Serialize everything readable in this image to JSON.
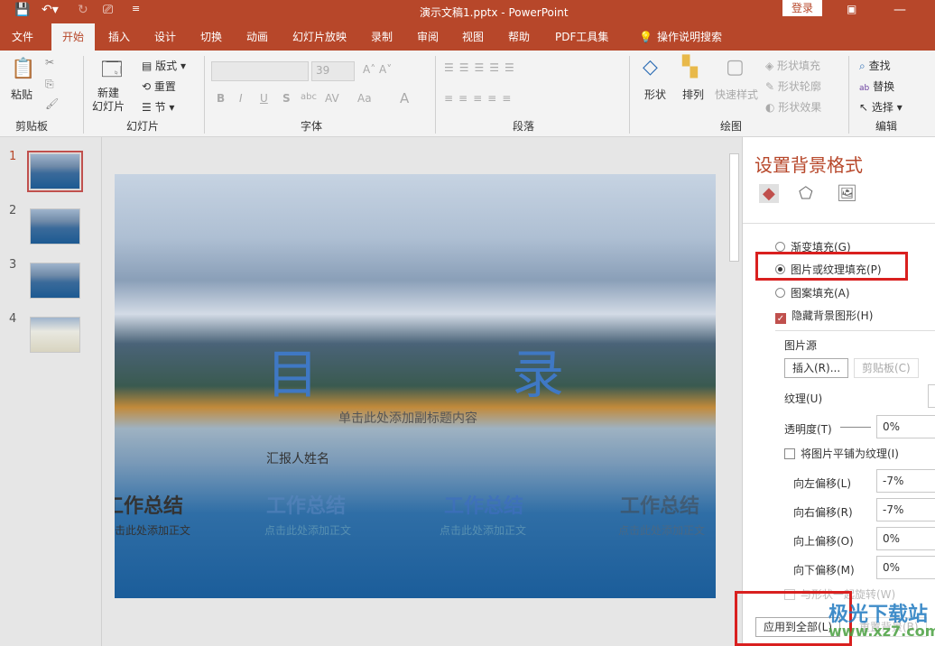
{
  "titlebar": {
    "title": "演示文稿1.pptx  -  PowerPoint",
    "login": "登录",
    "icons": [
      "save-icon",
      "undo-icon",
      "redo-icon",
      "present-icon",
      "customize-icon"
    ]
  },
  "tabs": [
    "文件",
    "开始",
    "插入",
    "设计",
    "切换",
    "动画",
    "幻灯片放映",
    "录制",
    "审阅",
    "视图",
    "帮助",
    "PDF工具集",
    "操作说明搜索"
  ],
  "ribbon": {
    "clipboard": {
      "paste": "粘贴",
      "group": "剪贴板"
    },
    "slides": {
      "new_slide": "新建\n幻灯片",
      "layout": "版式",
      "reset": "重置",
      "section": "节",
      "group": "幻灯片"
    },
    "font": {
      "size": "39",
      "group": "字体",
      "bold": "B",
      "italic": "I",
      "underline": "U",
      "shadow": "S",
      "strike": "abc",
      "spacing": "AV",
      "case": "Aa",
      "color": "A"
    },
    "paragraph": {
      "group": "段落"
    },
    "drawing": {
      "shape": "形状",
      "arrange": "排列",
      "quick_style": "快速样式",
      "fill": "形状填充",
      "outline": "形状轮廓",
      "effect": "形状效果",
      "group": "绘图"
    },
    "editing": {
      "find": "查找",
      "replace": "替换",
      "select": "选择",
      "group": "编辑"
    }
  },
  "thumbnails": [
    "1",
    "2",
    "3",
    "4"
  ],
  "slide": {
    "title_left": "目",
    "title_right": "录",
    "subtitle": "单击此处添加副标题内容",
    "reporter": "汇报人姓名",
    "sections": [
      {
        "title": "工作总结",
        "body": "点击此处添加正文"
      },
      {
        "title": "工作总结",
        "body": "点击此处添加正文"
      },
      {
        "title": "工作总结",
        "body": "点击此处添加正文"
      },
      {
        "title": "工作总结",
        "body": "点击此处添加正文"
      }
    ]
  },
  "panel": {
    "title": "设置背景格式",
    "gradient": "渐变填充(G)",
    "picture": "图片或纹理填充(P)",
    "pattern": "图案填充(A)",
    "hide": "隐藏背景图形(H)",
    "source": "图片源",
    "insert": "插入(R)...",
    "clipboard": "剪贴板(C)",
    "texture": "纹理(U)",
    "transparency": "透明度(T)",
    "transparency_value": "0%",
    "tile": "将图片平铺为纹理(I)",
    "offset_left": "向左偏移(L)",
    "offset_left_value": "-7%",
    "offset_right": "向右偏移(R)",
    "offset_right_value": "-7%",
    "offset_top": "向上偏移(O)",
    "offset_top_value": "0%",
    "offset_bottom": "向下偏移(M)",
    "offset_bottom_value": "0%",
    "rotate": "与形状一起旋转(W)",
    "apply_all": "应用到全部(L)",
    "reset": "重置背景(B)"
  },
  "watermark": {
    "name": "极光下载站",
    "url": "www.xz7.com"
  }
}
